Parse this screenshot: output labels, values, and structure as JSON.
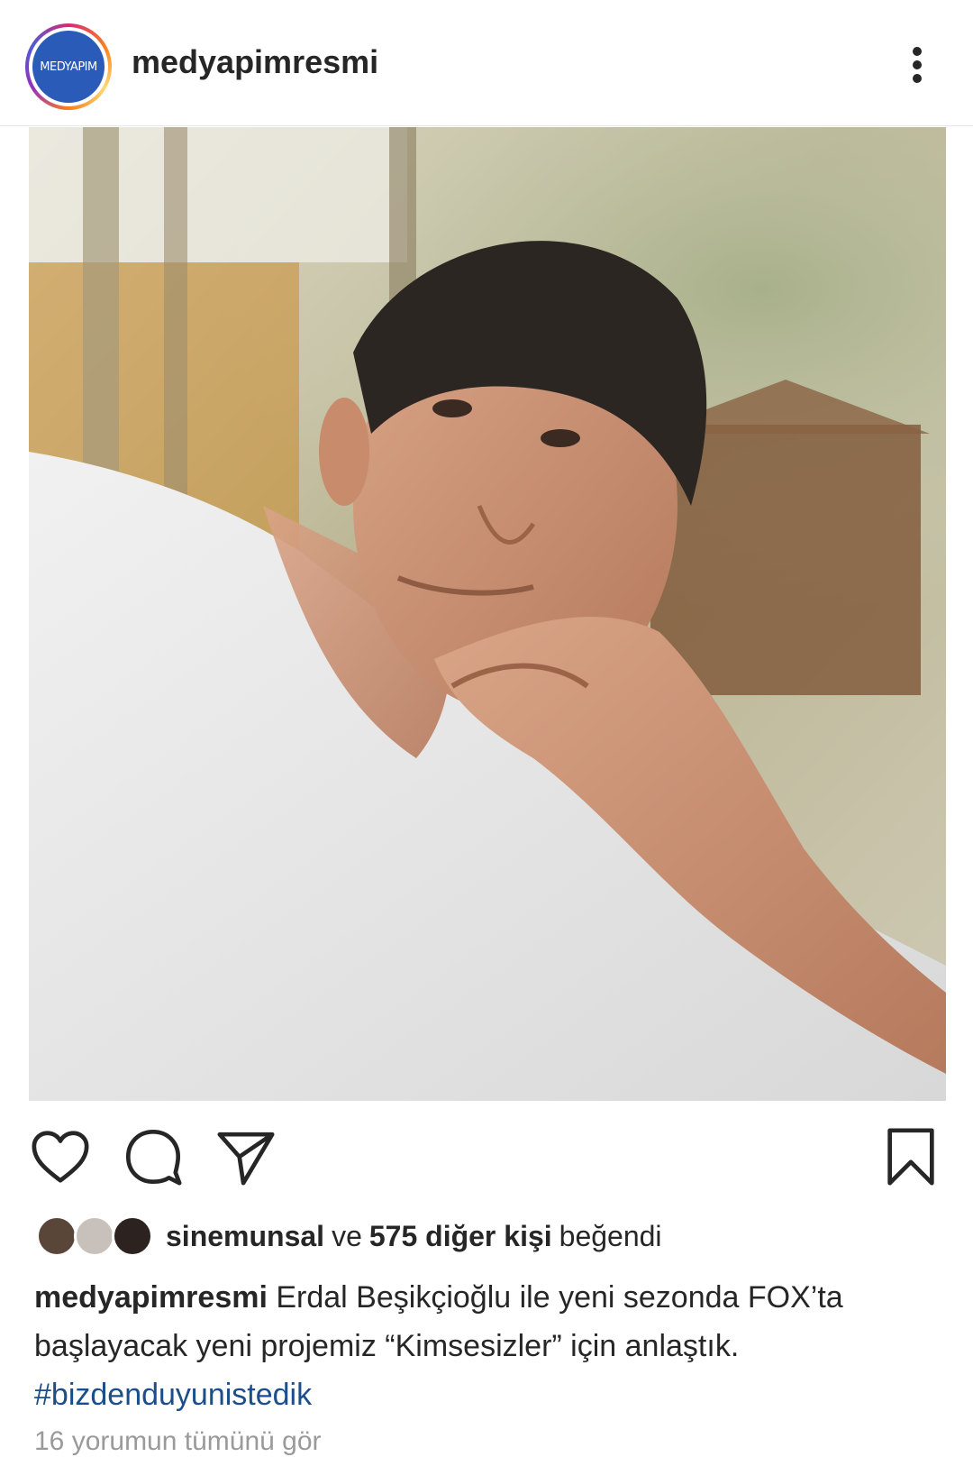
{
  "header": {
    "avatar_text": "MEDYAPIM",
    "username": "medyapimresmi"
  },
  "actions": {
    "like_icon": "heart-icon",
    "comment_icon": "comment-icon",
    "share_icon": "paper-plane-icon",
    "save_icon": "bookmark-icon"
  },
  "likes": {
    "user": "sinemunsal",
    "joiner": "ve",
    "count_text": "575 diğer kişi",
    "suffix": "beğendi"
  },
  "caption": {
    "user": "medyapimresmi",
    "text": "Erdal Beşikçioğlu ile yeni sezonda FOX’ta başlayacak yeni projemiz “Kimsesizler” için anlaştık.",
    "hashtag": "#bizdenduyunistedik"
  },
  "comments_link": "16 yorumun tümünü gör",
  "colors": {
    "hashtag": "#1b4e8a",
    "avatar_bg": "#2a5bb8"
  }
}
